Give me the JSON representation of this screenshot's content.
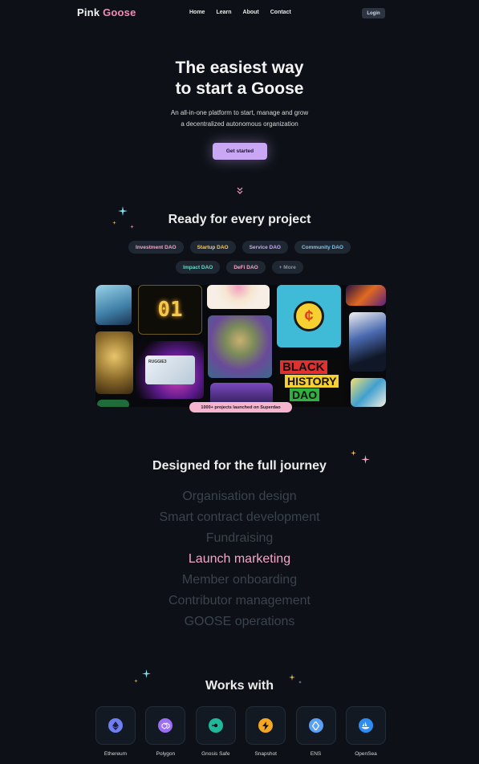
{
  "nav": {
    "logo_part1": "Pink",
    "logo_part2": "Goose",
    "links": [
      "Home",
      "Learn",
      "About",
      "Contact"
    ],
    "login": "Login"
  },
  "hero": {
    "title_line1": "The easiest way",
    "title_line2": "to start a Goose",
    "sub_line1": "An all-in-one platform to start, manage and grow",
    "sub_line2": "a decentralized autonomous organization",
    "cta": "Get started"
  },
  "projects": {
    "title": "Ready for every project",
    "tags_row1": [
      {
        "label": "Investment DAO",
        "color": "#f3a7c8"
      },
      {
        "label": "Startup DAO",
        "color": "#f5c86a"
      },
      {
        "label": "Service DAO",
        "color": "#c9a7f5"
      },
      {
        "label": "Community DAO",
        "color": "#7fc7f0"
      }
    ],
    "tags_row2": [
      {
        "label": "Impact DAO",
        "color": "#6fd8c9"
      },
      {
        "label": "DeFi DAO",
        "color": "#f3a7c8"
      },
      {
        "label": "+ More",
        "color": "#8a939e"
      }
    ],
    "gallery_text_01": "01",
    "gallery_card_text": "RUGGIE3",
    "gallery_black": "BLACK",
    "gallery_history": "HISTORY",
    "gallery_dao": "DAO",
    "badge": "1000+ projects launched on Superdao"
  },
  "journey": {
    "title": "Designed for the full journey",
    "items": [
      "Organisation design",
      "Smart contract development",
      "Fundraising",
      "Launch marketing",
      "Member onboarding",
      "Contributor management",
      "GOOSE operations"
    ],
    "active_index": 3
  },
  "works": {
    "title": "Works with",
    "items": [
      {
        "label": "Ethereum",
        "icon": "ethereum-icon",
        "color": "#6f7ff0"
      },
      {
        "label": "Polygon",
        "icon": "polygon-icon",
        "color": "#9b6ef3"
      },
      {
        "label": "Gnosis Safe",
        "icon": "gnosis-safe-icon",
        "color": "#1fb89a"
      },
      {
        "label": "Snapshot",
        "icon": "snapshot-icon",
        "color": "#f5a623"
      },
      {
        "label": "ENS",
        "icon": "ens-icon",
        "color": "#5aa0f5"
      },
      {
        "label": "OpenSea",
        "icon": "opensea-icon",
        "color": "#2f8cf0"
      }
    ]
  }
}
